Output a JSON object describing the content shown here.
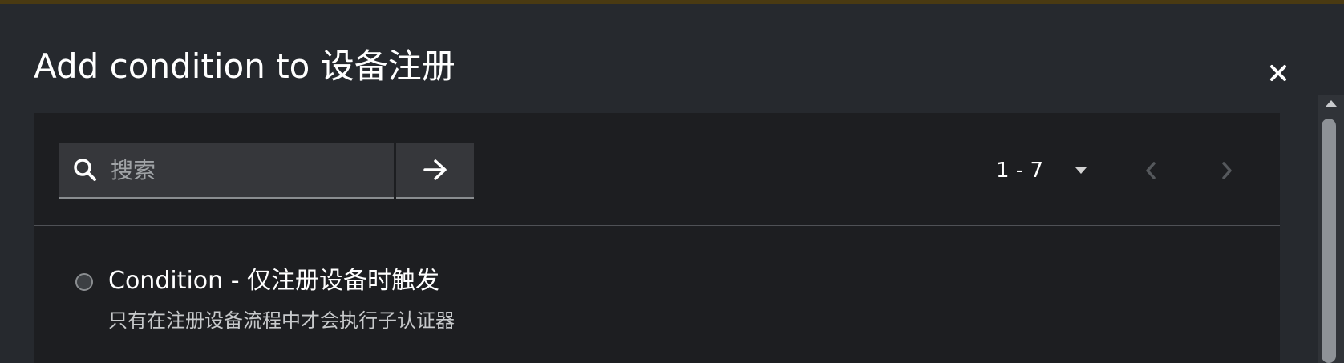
{
  "modal": {
    "title": "Add condition to 设备注册",
    "close_icon": "close-icon"
  },
  "search": {
    "placeholder": "搜索",
    "value": "",
    "icon": "search-icon",
    "go_icon": "arrow-right-icon"
  },
  "pagination": {
    "range": "1 - 7",
    "caret_icon": "caret-down-icon",
    "prev_icon": "chevron-left-icon",
    "next_icon": "chevron-right-icon"
  },
  "items": [
    {
      "title": "Condition - 仅注册设备时触发",
      "description": "只有在注册设备流程中才会执行子认证器",
      "selected": false
    }
  ],
  "colors": {
    "modal_bg": "#26292e",
    "panel_bg": "#1d1e21",
    "input_bg": "#36373b",
    "text_primary": "#ffffff",
    "text_secondary": "#c7c9cb",
    "disabled": "#55585c"
  }
}
